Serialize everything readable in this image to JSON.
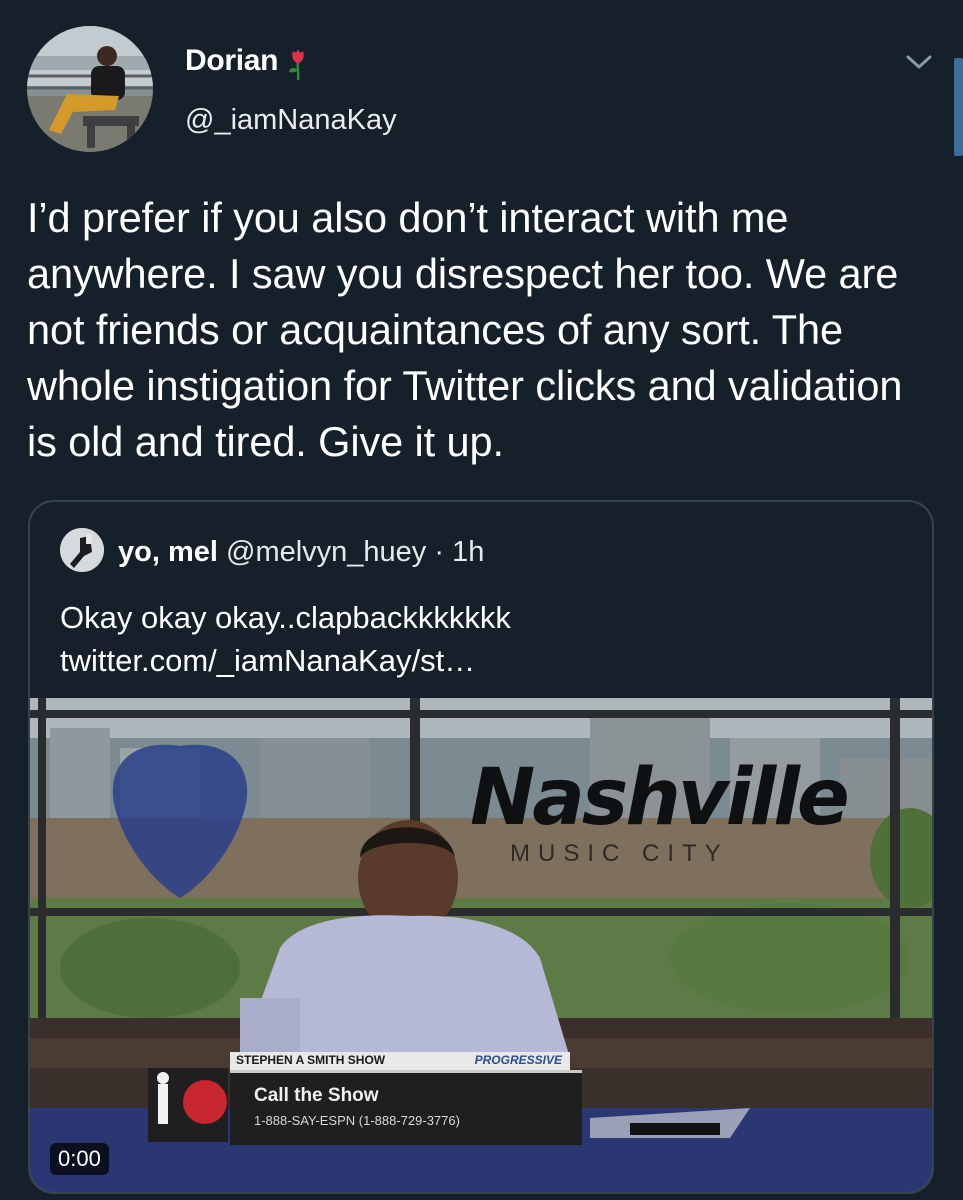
{
  "tweet": {
    "author_name": "Dorian",
    "author_handle": "@_iamNanaKay",
    "text": "I’d prefer if you also don’t interact with me anywhere. I saw you disrespect her too. We are not friends or acquaintances of any sort. The whole instigation for Twitter clicks and validation is old and tired. Give it up.",
    "name_emoji_icon": "rose-icon",
    "menu_icon": "chevron-down-icon"
  },
  "quoted": {
    "author_name": "yo, mel",
    "author_handle": "@melvyn_huey",
    "separator": "·",
    "time": "1h",
    "text": "Okay okay okay..clapbackkkkkkk twitter.com/_iamNanaKay/st…",
    "video": {
      "timestamp": "0:00",
      "background_sign": "Nashville",
      "background_sign_sub": "MUSIC CITY",
      "overlay_title": "Call the Show",
      "overlay_number": "1-888-SAY-ESPN (1-888-729-3776)",
      "ticker_label": "STEPHEN A SMITH SHOW",
      "ticker_sponsor": "PROGRESSIVE"
    }
  },
  "colors": {
    "background": "#15202b",
    "border": "#38444d",
    "scroll_accent": "#3b6e9e"
  }
}
